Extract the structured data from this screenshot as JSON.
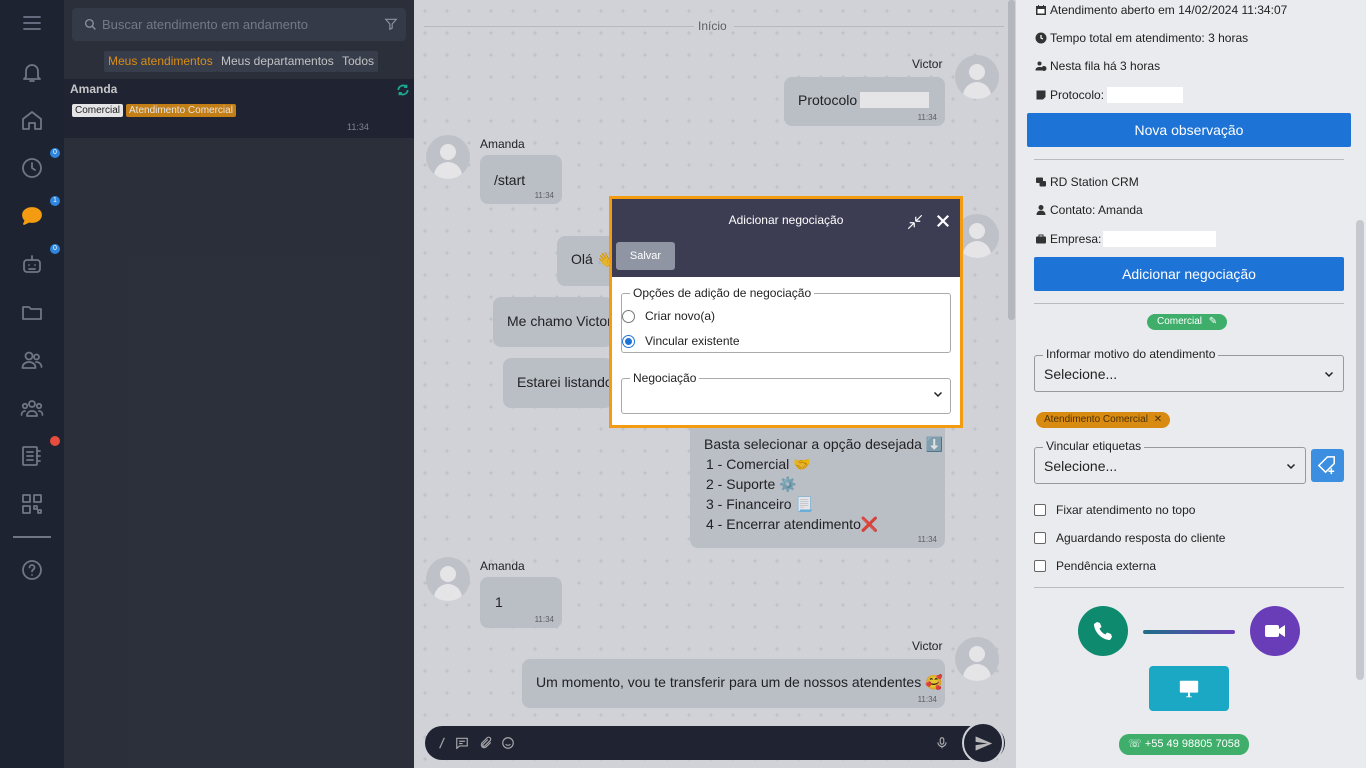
{
  "sidebar": {
    "badges": {
      "history": "0",
      "chats": "1",
      "bots": "0"
    },
    "icons": [
      "menu-icon",
      "bell-icon",
      "home-icon",
      "clock-icon",
      "chat-icon",
      "robot-icon",
      "folder-icon",
      "users-icon",
      "groups-icon",
      "contacts-icon",
      "qrcode-icon",
      "help-icon"
    ]
  },
  "list": {
    "search_placeholder": "Buscar atendimento em andamento",
    "tabs": [
      "Meus atendimentos",
      "Meus departamentos",
      "Todos"
    ],
    "conversation": {
      "name": "Amanda",
      "tag1": "Comercial",
      "tag2": "Atendimento Comercial",
      "time": "11:34"
    }
  },
  "chat": {
    "start_label": "Início",
    "messages": [
      {
        "from": "Victor",
        "text": "Protocolo",
        "time": "11:34"
      },
      {
        "from": "Amanda",
        "text": "/start",
        "time": "11:34"
      },
      {
        "text": "Olá 👋"
      },
      {
        "text": "Me chamo Victor"
      },
      {
        "text": "Estarei listando"
      },
      {
        "text_lines": [
          "Basta selecionar a opção desejada ⬇️",
          "1 - Comercial 🤝",
          "2 - Suporte ⚙️",
          "3 - Financeiro 📃",
          "4 - Encerrar atendimento❌"
        ],
        "time": "11:34"
      },
      {
        "from": "Amanda",
        "text": "1",
        "time": "11:34"
      },
      {
        "from": "Victor",
        "text": "Um momento, vou te transferir para um de nossos atendentes 🥰",
        "time": "11:34"
      }
    ]
  },
  "modal": {
    "title": "Adicionar negociação",
    "save_label": "Salvar",
    "options_legend": "Opções de adição de negociação",
    "option1": "Criar novo(a)",
    "option2": "Vincular existente",
    "selected_option": "Vincular existente",
    "negociacao_legend": "Negociação",
    "negociacao_value": ""
  },
  "panel": {
    "opened": "Atendimento aberto em 14/02/2024 11:34:07",
    "total_time": "Tempo total em atendimento: 3 horas",
    "queue": "Nesta fila há 3 horas",
    "protocol_label": "Protocolo:",
    "new_note_button": "Nova observação",
    "crm_title": "RD Station CRM",
    "contact": "Contato: Amanda",
    "company_label": "Empresa:",
    "add_deal_button": "Adicionar negociação",
    "department_pill": "Comercial",
    "reason_legend": "Informar motivo do atendimento",
    "reason_value": "Selecione...",
    "tag_pill": "Atendimento Comercial",
    "tags_legend": "Vincular etiquetas",
    "tags_value": "Selecione...",
    "check1": "Fixar atendimento no topo",
    "check2": "Aguardando resposta do cliente",
    "check3": "Pendência externa",
    "phone": "+55 49 98805 7058",
    "colors": {
      "call": "#0e8a6e",
      "video": "#6a3db8",
      "screen": "#1aa8c4",
      "accent": "#f39c12",
      "blue": "#1e73d6"
    }
  }
}
